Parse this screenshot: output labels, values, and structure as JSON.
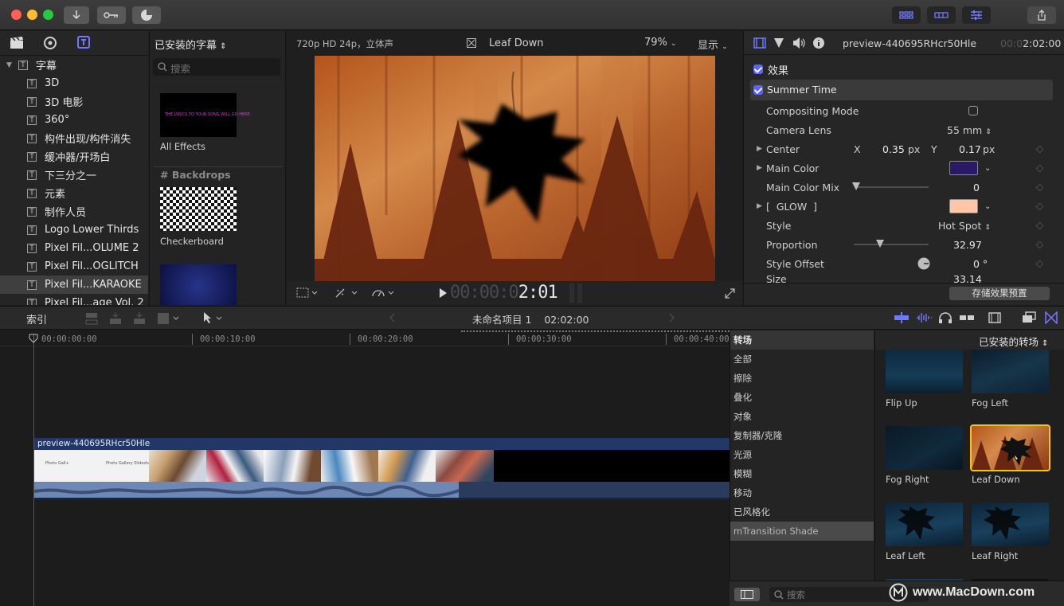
{
  "titlebar": {
    "icons": [
      "download-icon",
      "key-icon",
      "progress-icon"
    ],
    "right_icons": [
      "library-layout-icon",
      "timeline-layout-icon",
      "inspector-toggle-icon",
      "share-icon"
    ]
  },
  "library": {
    "root_label": "字幕",
    "items": [
      "3D",
      "3D 电影",
      "360°",
      "构件出现/构件消失",
      "缓冲器/开场白",
      "下三分之一",
      "元素",
      "制作人员",
      "Logo Lower Thirds",
      "Pixel Fil...OLUME 2",
      "Pixel Fil...OGLITCH",
      "Pixel Fil...KARAOKE",
      "Pixel Fil...age Vol. 2"
    ],
    "selected_index": 11
  },
  "browser": {
    "header": "已安装的字幕",
    "search_placeholder": "搜索",
    "all_effects_label": "All Effects",
    "section": "# Backdrops",
    "checkerboard_label": "Checkerboard",
    "tiny_text": "THE LYRICS TO YOUR SONG WILL GO HERE"
  },
  "viewer": {
    "format": "720p HD 24p，立体声",
    "clip_name": "Leaf Down",
    "zoom": "79%",
    "display_label": "显示",
    "timecode_dim": "00:00:0",
    "timecode_bright": "2:01"
  },
  "inspector": {
    "clip_name": "preview-440695RHcr50Hle",
    "duration_dim": "00:0",
    "duration_bright": "2:02:00",
    "effects_label": "效果",
    "effect_name": "Summer Time",
    "rows": {
      "compositing": "Compositing Mode",
      "camera_lens": "Camera Lens",
      "camera_lens_value": "55 mm",
      "center": "Center",
      "center_x_label": "X",
      "center_x": "0.35",
      "center_y_label": "Y",
      "center_y": "0.17",
      "unit_px": "px",
      "main_color": "Main Color",
      "main_color_mix": "Main Color Mix",
      "main_color_mix_value": "0",
      "glow": "[  GLOW  ]",
      "style": "Style",
      "style_value": "Hot Spot",
      "proportion": "Proportion",
      "proportion_value": "32.97",
      "style_offset": "Style Offset",
      "style_offset_value": "0 °",
      "size": "Size",
      "size_value": "33.14"
    },
    "save_preset": "存储效果预置",
    "main_color_hex": "#2a1a66",
    "glow_color_hex": "#ffc6a8"
  },
  "toolbar2": {
    "index_label": "索引",
    "project_name": "未命名项目 1",
    "project_duration": "02:02:00"
  },
  "timeline": {
    "ruler": [
      "00:00:00:00",
      "00:00:10:00",
      "00:00:20:00",
      "00:00:30:00",
      "00:00:40:00"
    ],
    "clip_name": "preview-440695RHcr50Hle",
    "clip_thumb_texts": [
      "Photo Gall+",
      "Photo Gallery Slideshow"
    ]
  },
  "transitions": {
    "header_left": "转场",
    "header_right": "已安装的转场",
    "categories": [
      "全部",
      "擦除",
      "叠化",
      "对象",
      "复制器/克隆",
      "光源",
      "模糊",
      "移动",
      "已风格化",
      "mTransition Shade"
    ],
    "selected_category_index": 9,
    "items": [
      "Flip Up",
      "Fog Left",
      "Fog Right",
      "Leaf Down",
      "Leaf Left",
      "Leaf Right"
    ],
    "selected_item_index": 3,
    "search_placeholder": "搜索"
  },
  "watermark": "www.MacDown.com"
}
